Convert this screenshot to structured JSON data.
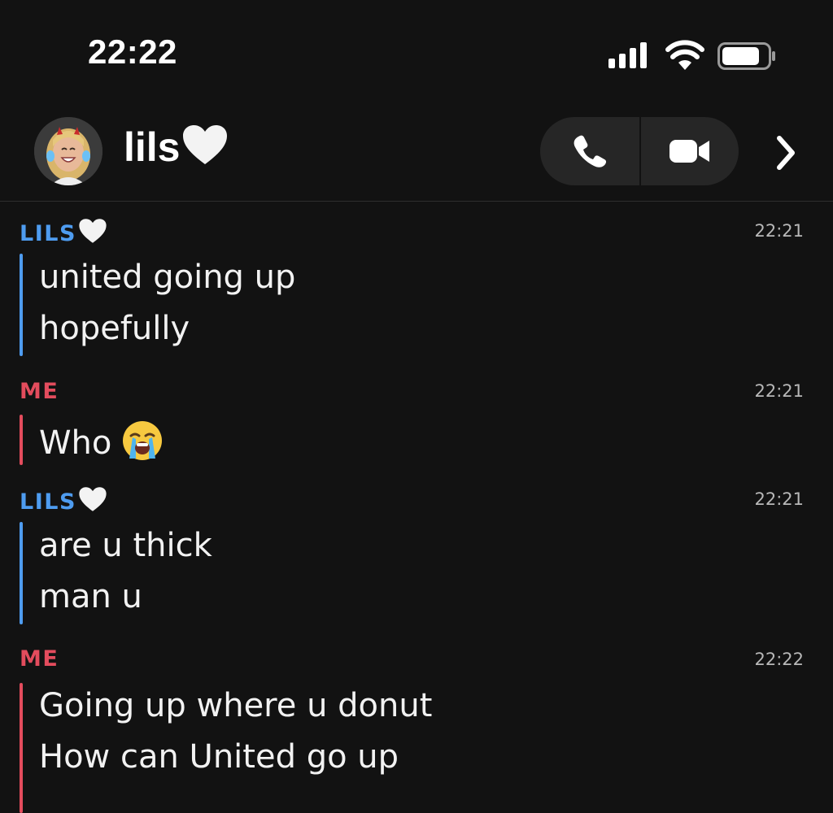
{
  "status_bar": {
    "time": "22:22"
  },
  "header": {
    "contact_name": "lils",
    "contact_emoji": "white-heart-icon",
    "avatar": "bitmoji-avatar"
  },
  "colors": {
    "background": "#121212",
    "lils_accent": "#4e9cf0",
    "me_accent": "#e34c5d",
    "timestamp": "#b8b8b8",
    "button_bg": "#262626"
  },
  "messages": [
    {
      "sender": "LILS",
      "sender_has_heart": true,
      "time": "22:21",
      "lines": [
        "united going up",
        "hopefully"
      ]
    },
    {
      "sender": "ME",
      "sender_has_heart": false,
      "time": "22:21",
      "lines": [
        "Who"
      ],
      "trailing_emoji": "loudly-crying-face-icon"
    },
    {
      "sender": "LILS",
      "sender_has_heart": true,
      "time": "22:21",
      "lines": [
        "are u thick",
        "man u"
      ]
    },
    {
      "sender": "ME",
      "sender_has_heart": false,
      "time": "22:22",
      "lines": [
        "Going up where u donut",
        "How can United go up"
      ]
    }
  ]
}
